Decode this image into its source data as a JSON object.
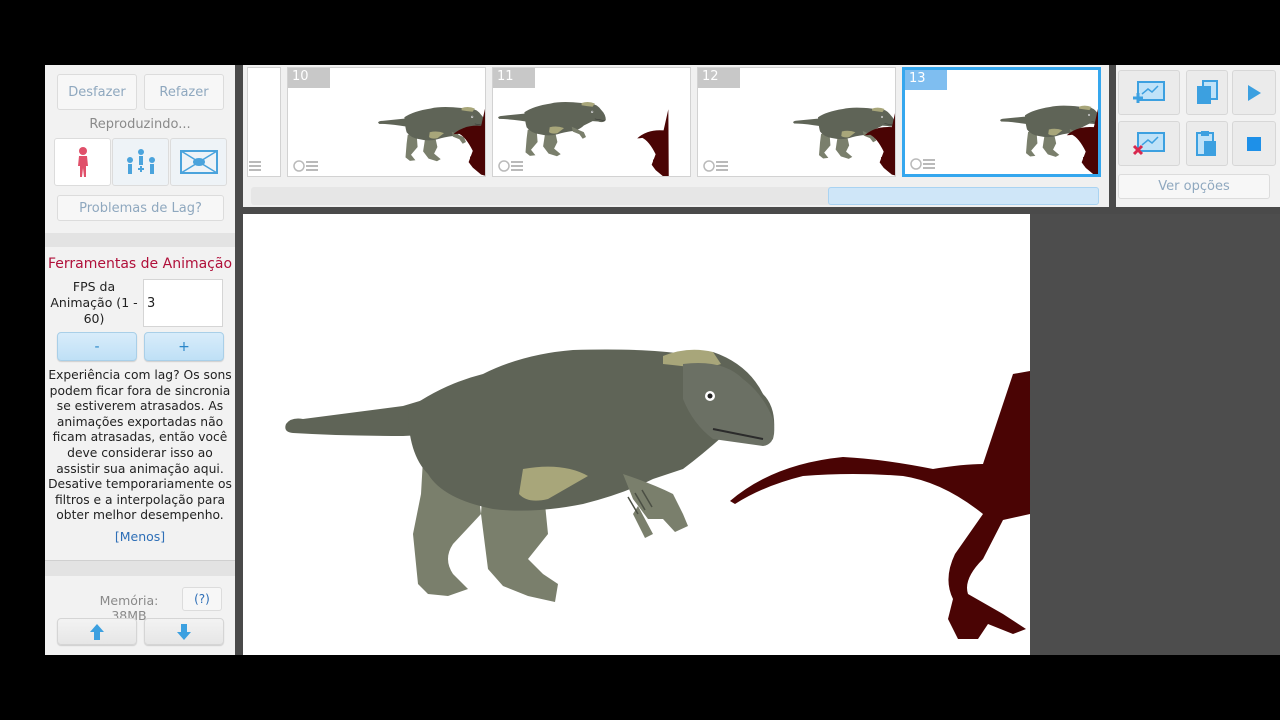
{
  "left_panel": {
    "undo_label": "Desfazer",
    "redo_label": "Refazer",
    "playing_status": "Reproduzindo...",
    "lag_problems_label": "Problemas de Lag?",
    "tools_title": "Ferramentas de Animação",
    "fps_label": "FPS da Animação (1 - 60)",
    "fps_value": "3",
    "minus_label": "-",
    "plus_label": "+",
    "lag_info": "Experiência com lag? Os sons podem ficar fora de sincronia se estiverem atrasados. As animações exportadas não ficam atrasadas, então você deve considerar isso ao assistir sua animação aqui. Desative temporariamente os filtros e a interpolação para obter melhor desempenho.",
    "less_link": "[Menos]",
    "memory_label": "Memória: 38MB",
    "help_label": "(?)"
  },
  "timeline": {
    "frames": [
      {
        "number": "10",
        "selected": false
      },
      {
        "number": "11",
        "selected": false
      },
      {
        "number": "12",
        "selected": false
      },
      {
        "number": "13",
        "selected": true
      }
    ]
  },
  "right_panel": {
    "view_options_label": "Ver opções"
  },
  "colors": {
    "accent_blue": "#35a7ee",
    "title_red": "#b0103a",
    "stickfigure_red": "#e0506a",
    "dino_green": "#5f6457",
    "dino_red": "#4a0404"
  }
}
